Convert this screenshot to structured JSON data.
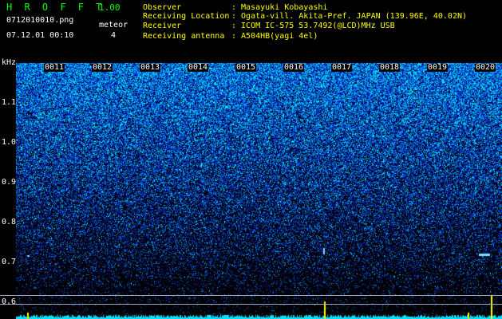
{
  "header": {
    "app_title": "H R O F F T",
    "version": "1.00",
    "filename": "0712010010.png",
    "datetime": "07.12.01 00:10",
    "meteor_label": "meteor",
    "meteor_count": "4"
  },
  "info": {
    "observer_label": "Observer",
    "observer_value": ": Masayuki Kobayashi",
    "location_label": "Receiving Location",
    "location_value": ": Ogata-vill. Akita-Pref. JAPAN (139.96E, 40.02N)",
    "receiver_label": "Receiver",
    "receiver_value": ": ICOM IC-575 53.7492(@LCD)MHz USB",
    "antenna_label": "Receiving antenna",
    "antenna_value": ": A504HB(yagi 4el)"
  },
  "axis": {
    "unit": "kHz",
    "y_ticks": [
      "1.1",
      "1.0",
      "0.9",
      "0.8",
      "0.7",
      "0.6"
    ],
    "x_ticks": [
      "0011",
      "0012",
      "0013",
      "0014",
      "0015",
      "0016",
      "0017",
      "0018",
      "0019",
      "0020"
    ]
  },
  "colors": {
    "background": "#000000",
    "title_green": "#00ff00",
    "text_yellow": "#ffff00",
    "spectrum_hot": "#00ffff",
    "spectrum_cold": "#0000a0",
    "signal": "#ffff00"
  }
}
